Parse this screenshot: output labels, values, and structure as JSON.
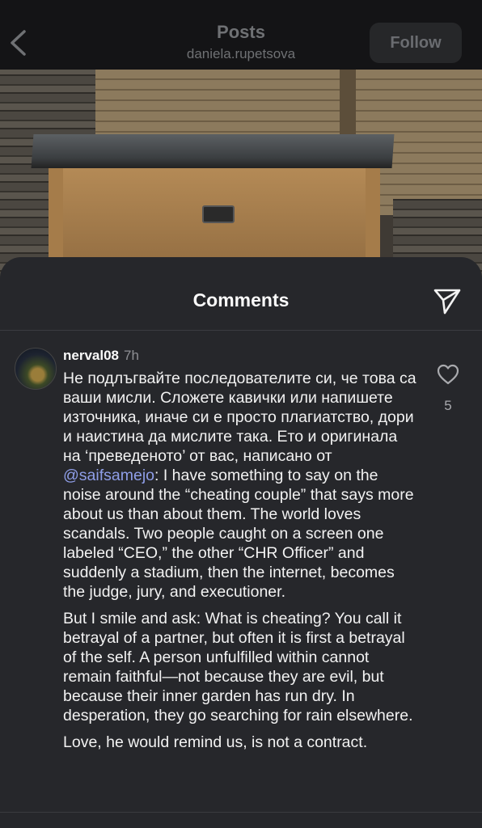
{
  "header": {
    "title": "Posts",
    "username": "daniela.rupetsova",
    "follow_label": "Follow"
  },
  "icons": {
    "back": "chevron-left-icon",
    "share": "send-icon",
    "like": "heart-icon"
  },
  "comments_sheet": {
    "title": "Comments",
    "comment": {
      "username": "nerval08",
      "time": "7h",
      "likes": "5",
      "text_part1": "Не подлъгвайте последователите си, че това са ваши мисли. Сложете кавички или напишете източника, иначе си е просто плагиатство, дори и наистина да мислите така. Ето и оригинала на ‘преведеното’ от вас, написано от ",
      "mention": "@saifsamejo",
      "text_part2": ": I have something to say on the noise around the “cheating couple” that says more about us than about them. The world loves scandals. Two people caught on a screen one labeled “CEO,” the other “CHR Officer” and suddenly a stadium, then the internet, becomes the judge, jury, and executioner.",
      "paragraph2": "But I smile and ask: What is cheating? You call it betrayal of a partner, but often it is first a betrayal of the self. A person unfulfilled within cannot remain faithful—not because they are evil, but because their inner garden has run dry. In desperation, they go searching for rain elsewhere.",
      "paragraph3": "Love, he would remind us, is not a contract."
    }
  },
  "colors": {
    "sheet_bg": "#26272b",
    "mention": "#8f9ee8",
    "header_bg": "#141416"
  }
}
